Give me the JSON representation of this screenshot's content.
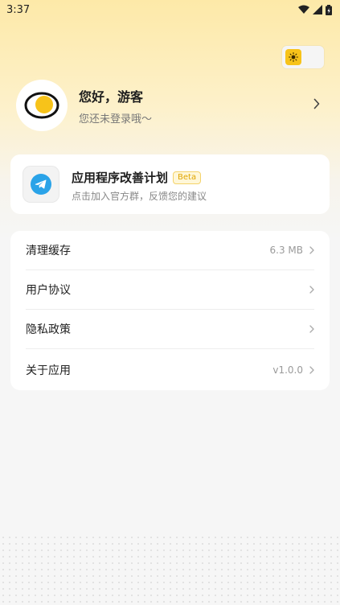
{
  "status_bar": {
    "time": "3:37"
  },
  "profile": {
    "name": "您好，游客",
    "subtitle": "您还未登录哦～"
  },
  "promo": {
    "title": "应用程序改善计划",
    "badge": "Beta",
    "subtitle": "点击加入官方群，反馈您的建议"
  },
  "settings": {
    "items": [
      {
        "label": "清理缓存",
        "value": "6.3 MB"
      },
      {
        "label": "用户协议",
        "value": ""
      },
      {
        "label": "隐私政策",
        "value": ""
      },
      {
        "label": "关于应用",
        "value": "v1.0.0"
      }
    ]
  },
  "colors": {
    "accent": "#f7c31a",
    "telegram": "#2aa3e8"
  },
  "icons": {
    "theme": "sun-icon",
    "promo": "telegram-icon",
    "row": "chevron-right-icon"
  }
}
